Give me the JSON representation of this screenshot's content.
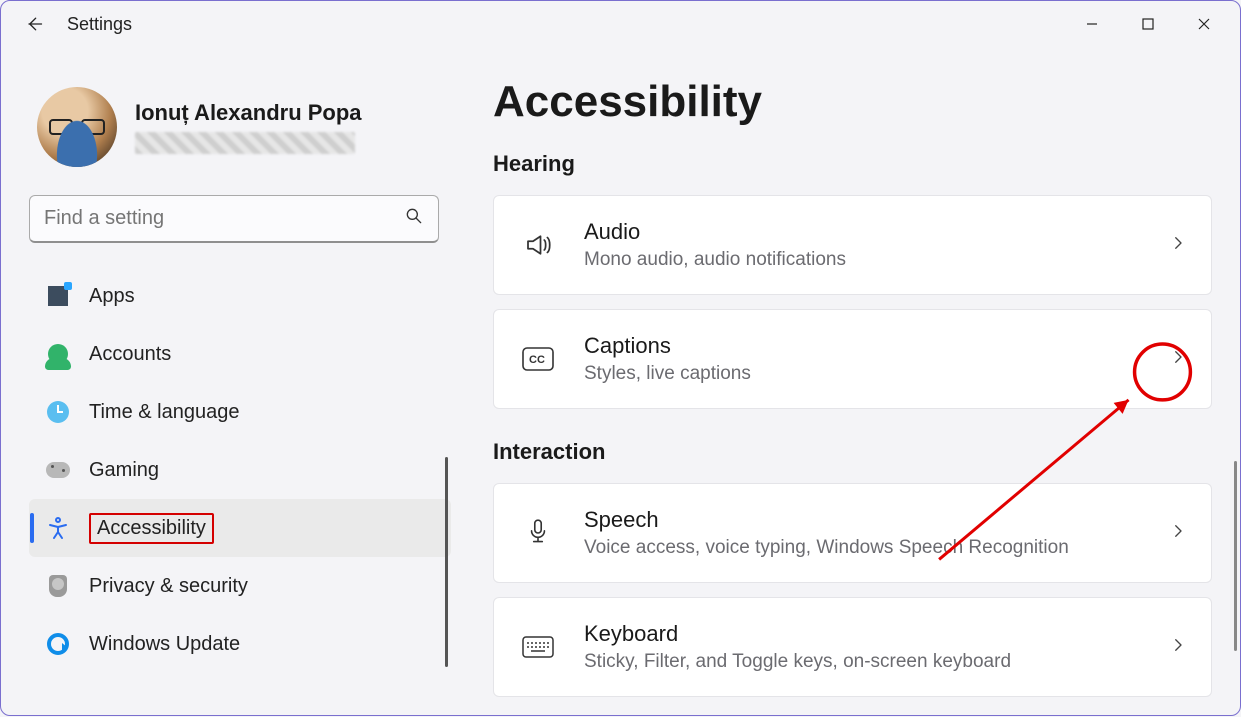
{
  "app_title": "Settings",
  "profile": {
    "name": "Ionuț Alexandru Popa"
  },
  "search": {
    "placeholder": "Find a setting"
  },
  "sidebar": {
    "items": [
      {
        "label": "Apps"
      },
      {
        "label": "Accounts"
      },
      {
        "label": "Time & language"
      },
      {
        "label": "Gaming"
      },
      {
        "label": "Accessibility"
      },
      {
        "label": "Privacy & security"
      },
      {
        "label": "Windows Update"
      }
    ]
  },
  "page": {
    "title": "Accessibility",
    "groups": [
      {
        "title": "Hearing",
        "items": [
          {
            "title": "Audio",
            "sub": "Mono audio, audio notifications"
          },
          {
            "title": "Captions",
            "sub": "Styles, live captions"
          }
        ]
      },
      {
        "title": "Interaction",
        "items": [
          {
            "title": "Speech",
            "sub": "Voice access, voice typing, Windows Speech Recognition"
          },
          {
            "title": "Keyboard",
            "sub": "Sticky, Filter, and Toggle keys, on-screen keyboard"
          }
        ]
      }
    ]
  },
  "selected_sidebar_index": 4,
  "annotation": {
    "target": "captions-chevron"
  }
}
